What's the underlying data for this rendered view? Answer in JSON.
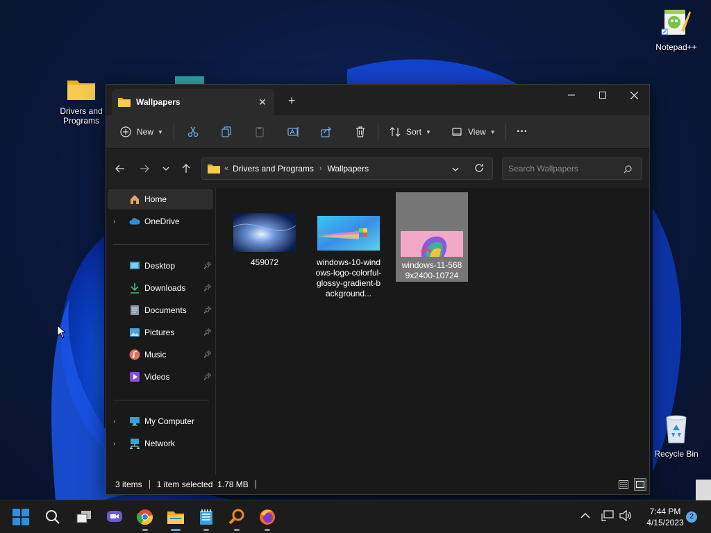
{
  "desktop": {
    "icons": [
      {
        "label_line1": "Drivers and",
        "label_line2": "Programs"
      },
      {
        "label_line1": "Notepad++",
        "label_line2": ""
      },
      {
        "label_line1": "Recycle Bin",
        "label_line2": ""
      }
    ]
  },
  "window": {
    "tab_title": "Wallpapers",
    "new_tab_symbol": "+",
    "toolbar": {
      "new_label": "New",
      "sort_label": "Sort",
      "view_label": "View",
      "more_label": "···"
    },
    "address": {
      "overflow": "«",
      "crumbs": [
        "Drivers and Programs",
        "Wallpapers"
      ]
    },
    "search_placeholder": "Search Wallpapers",
    "nav": {
      "home": "Home",
      "onedrive": "OneDrive",
      "desktop": "Desktop",
      "downloads": "Downloads",
      "documents": "Documents",
      "pictures": "Pictures",
      "music": "Music",
      "videos": "Videos",
      "my_computer": "My Computer",
      "network": "Network"
    },
    "files": [
      {
        "name": "459072",
        "selected": false
      },
      {
        "name": "windows-10-windows-logo-colorful-glossy-gradient-background...",
        "selected": false
      },
      {
        "name": "windows-11-5689x2400-10724",
        "selected": true
      }
    ],
    "status": {
      "items": "3 items",
      "selection": "1 item selected  1.78 MB"
    }
  },
  "taskbar": {
    "time": "7:44 PM",
    "date": "4/15/2023",
    "notifications": "2"
  },
  "colors": {
    "accent": "#5ba7e8",
    "folder": "#f4c542",
    "window_bg": "#191919",
    "toolbar_bg": "#2b2b2b"
  }
}
